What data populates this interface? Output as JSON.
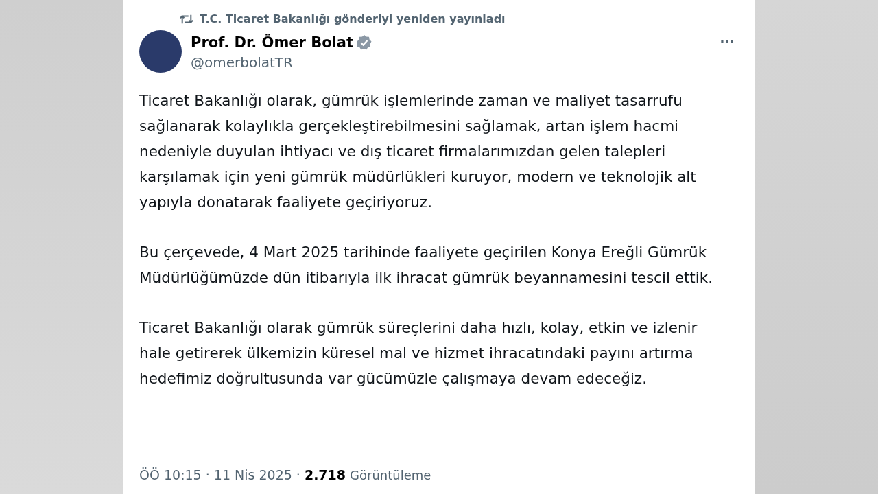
{
  "repost_note": "T.C. Ticaret Bakanlığı gönderiyi yeniden yayınladı",
  "author": {
    "name": "Prof. Dr. Ömer Bolat",
    "verified": true,
    "handle": "@omerbolatTR"
  },
  "more_button": "···",
  "paragraphs": [
    "Ticaret Bakanlığı olarak, gümrük işlemlerinde zaman ve maliyet tasarrufu sağlanarak kolaylıkla gerçekleştirebilmesini sağlamak, artan işlem hacmi nedeniyle duyulan ihtiyacı ve dış ticaret firmalarımızdan gelen talepleri karşılamak için yeni gümrük müdürlükleri kuruyor, modern ve teknolojik alt yapıyla donatarak faaliyete geçiriyoruz.",
    "Bu çerçevede, 4 Mart 2025 tarihinde faaliyete geçirilen Konya Ereğli Gümrük Müdürlüğümüzde dün itibarıyla ilk ihracat gümrük beyannamesini tescil ettik.",
    "Ticaret Bakanlığı olarak gümrük süreçlerini daha hızlı, kolay, etkin ve izlenir hale getirerek ülkemizin küresel mal ve hizmet ihracatındaki payını artırma hedefimiz doğrultusunda var gücümüzle çalışmaya devam edeceğiz."
  ],
  "footer": {
    "timestamp": "ÖÖ 10:15 · 11 Nis 2025 ·",
    "views_count": "2.718",
    "views_label": "Görüntüleme"
  }
}
